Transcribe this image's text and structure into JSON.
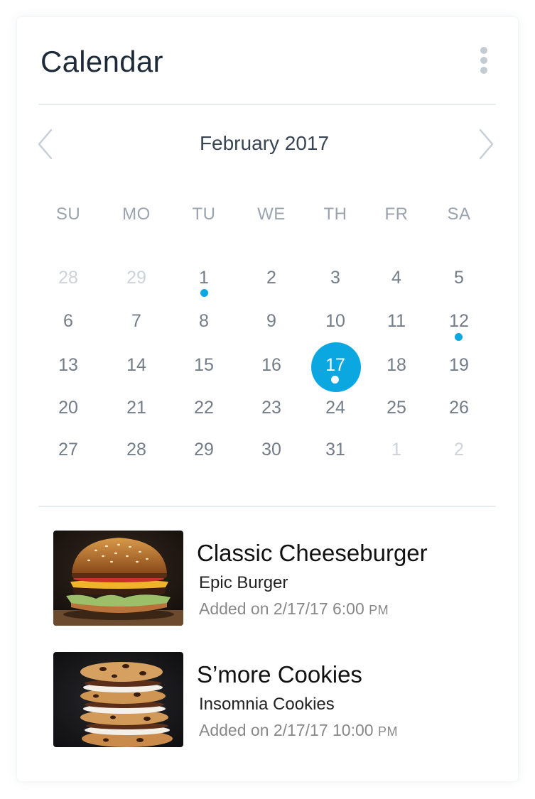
{
  "header": {
    "title": "Calendar",
    "menu_icon": "more-vertical-icon"
  },
  "calendar": {
    "month_label": "February 2017",
    "prev_icon": "chevron-left-icon",
    "next_icon": "chevron-right-icon",
    "weekdays": [
      "SU",
      "MO",
      "TU",
      "WE",
      "TH",
      "FR",
      "SA"
    ],
    "weeks": [
      [
        "28",
        "29",
        "1",
        "2",
        "3",
        "4",
        "5"
      ],
      [
        "6",
        "7",
        "8",
        "9",
        "10",
        "11",
        "12"
      ],
      [
        "13",
        "14",
        "15",
        "16",
        "17",
        "18",
        "19"
      ],
      [
        "20",
        "21",
        "22",
        "23",
        "24",
        "25",
        "26"
      ],
      [
        "27",
        "28",
        "29",
        "30",
        "31",
        "1",
        "2"
      ]
    ],
    "outside_month_days": [
      "28 Jan",
      "29 Jan",
      "1 Mar",
      "2 Mar"
    ],
    "selected_day": "17",
    "days_with_events": [
      "1",
      "12",
      "17"
    ],
    "accent_color": "#0aa7e1"
  },
  "events": [
    {
      "title": "Classic Cheeseburger",
      "place": "Epic Burger",
      "added_prefix": "Added on 2/17/17 6:00",
      "added_ampm": "PM",
      "image": "burger-photo"
    },
    {
      "title": "S’more Cookies",
      "place": "Insomnia Cookies",
      "added_prefix": "Added on 2/17/17 10:00",
      "added_ampm": "PM",
      "image": "cookies-photo"
    }
  ]
}
